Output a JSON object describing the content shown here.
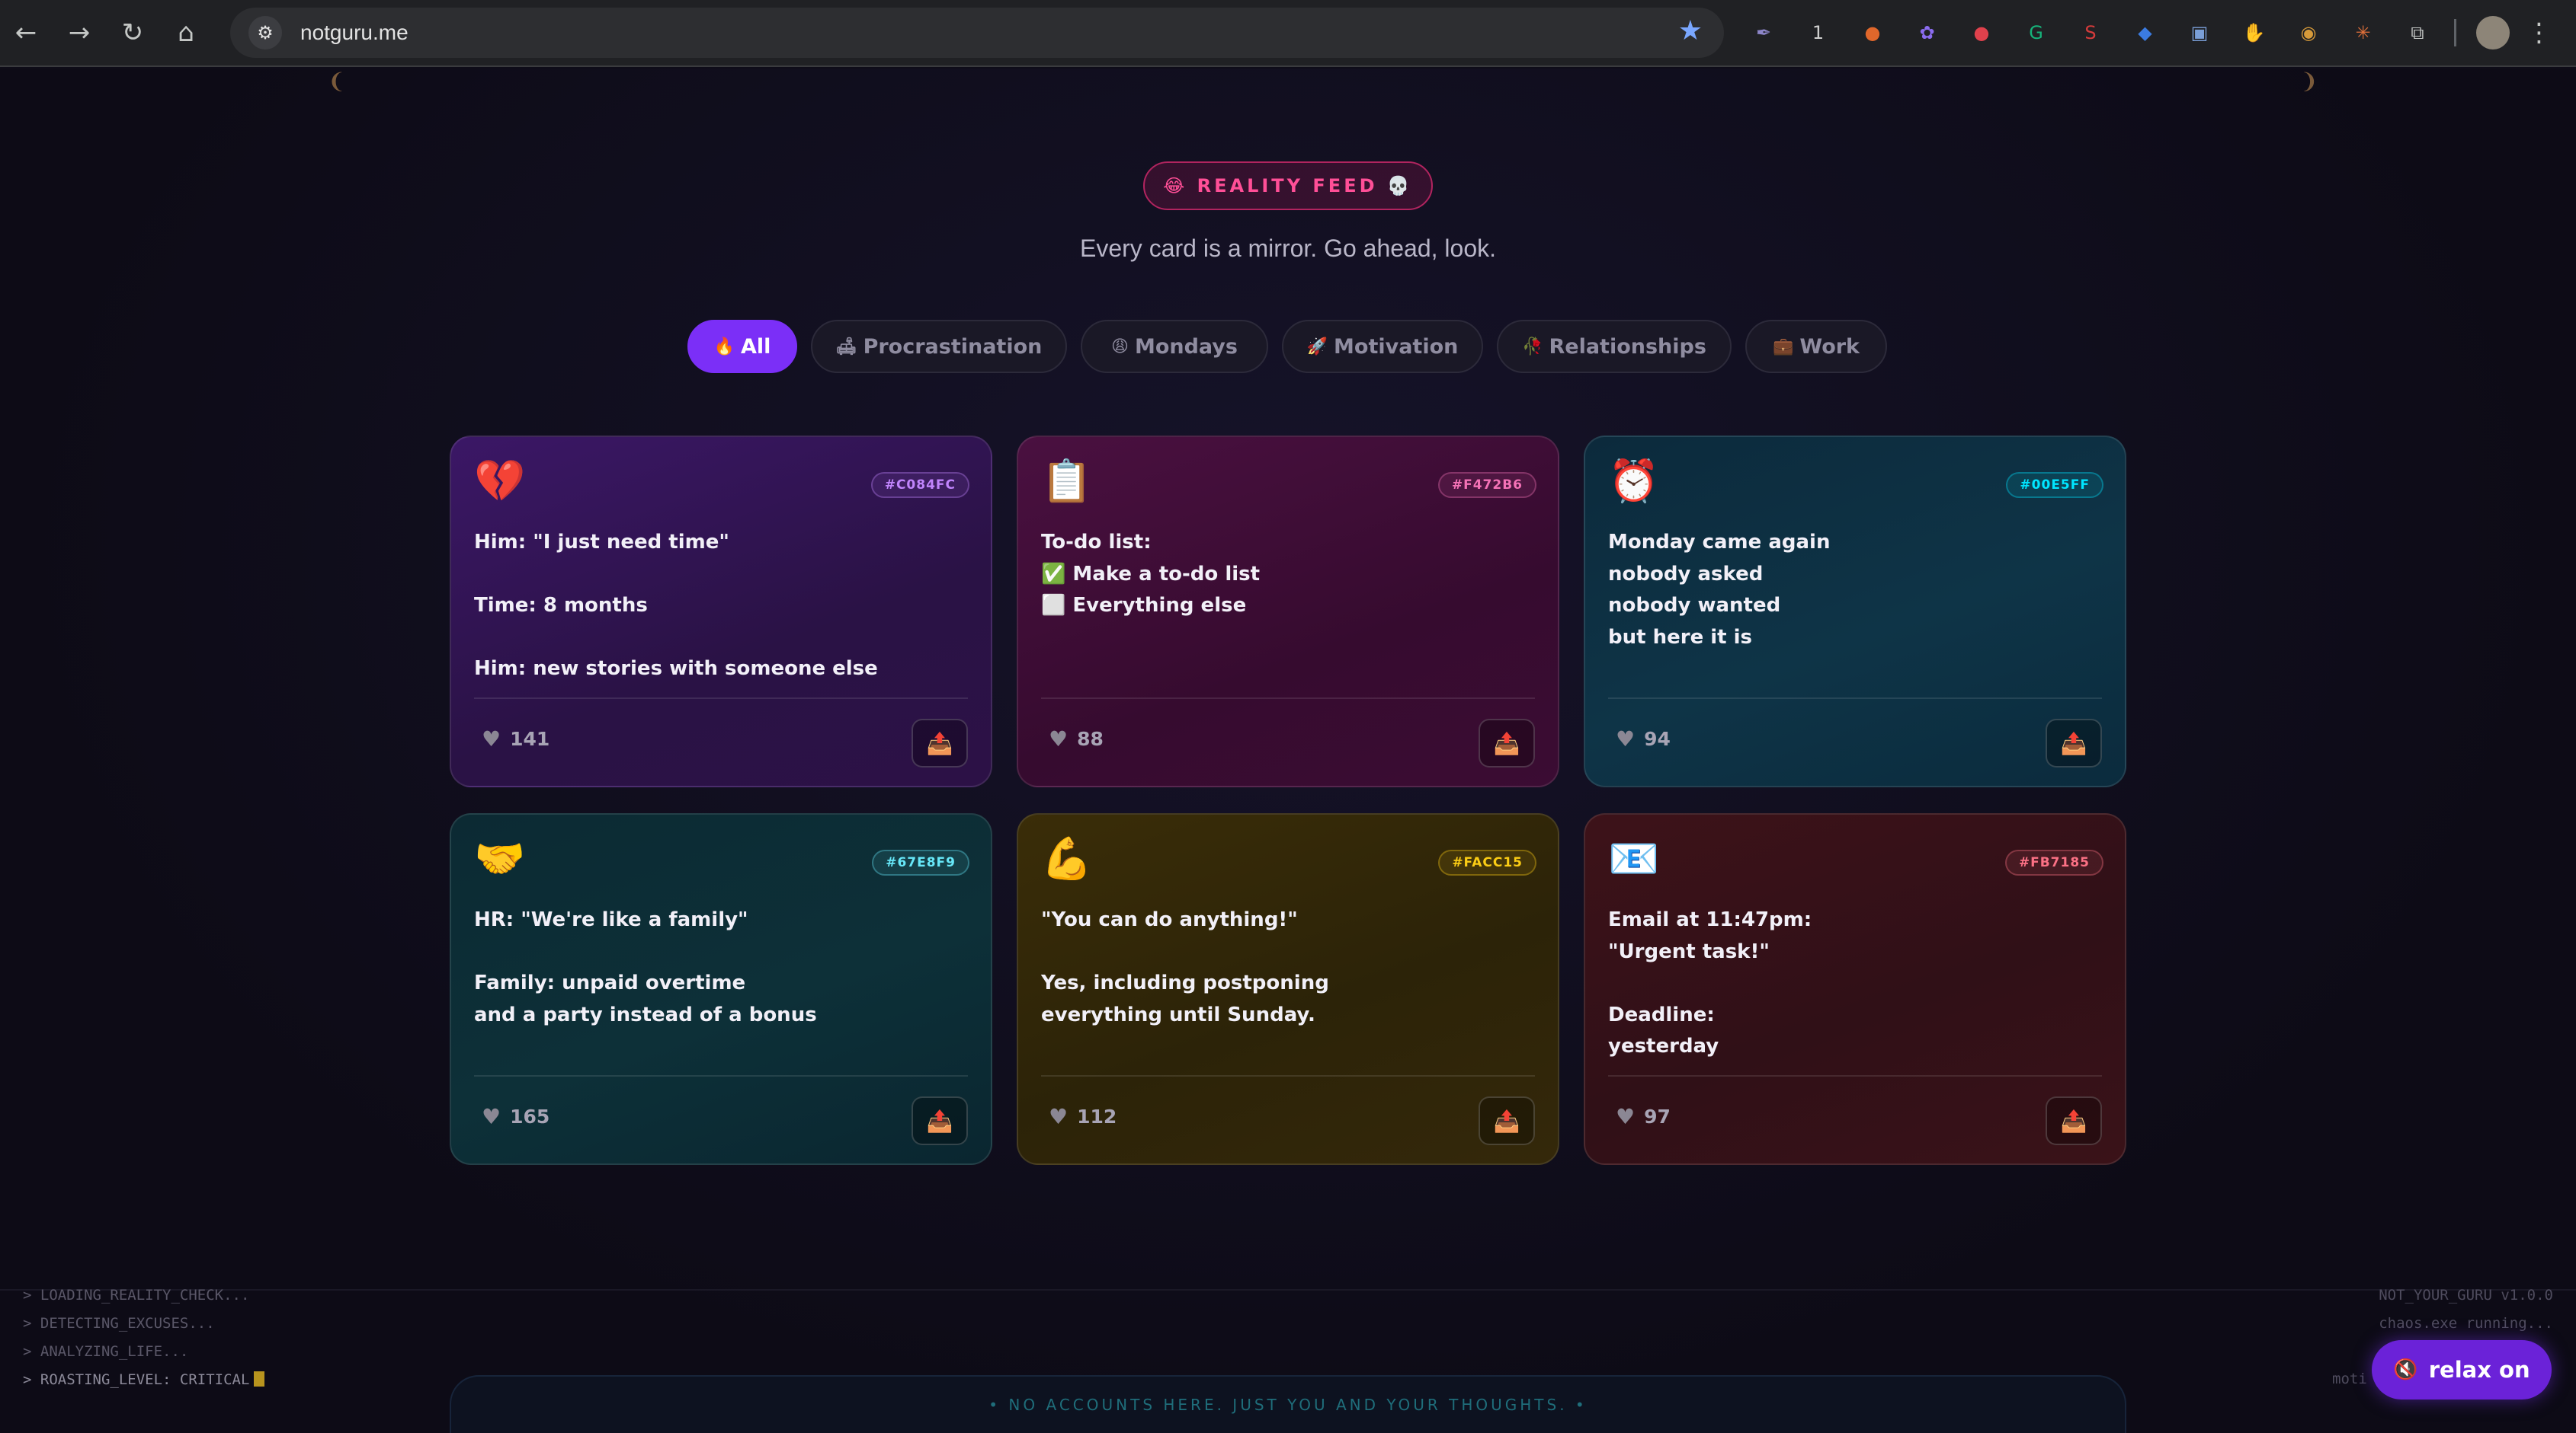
{
  "browser": {
    "url": "notguru.me",
    "nav": {
      "back": "←",
      "forward": "→",
      "reload": "↻",
      "home": "⌂"
    },
    "icons": {
      "site_settings": "site-settings-icon",
      "bookmark_star": "star-icon",
      "menu": "more-vert-icon"
    },
    "extensions": [
      {
        "name": "feather-extension-icon",
        "glyph": "✒",
        "color": "#8d86c9"
      },
      {
        "name": "password-extension-icon",
        "glyph": "1",
        "color": "#cfcfcf"
      },
      {
        "name": "orange-extension-icon",
        "glyph": "●",
        "color": "#e0672b"
      },
      {
        "name": "gear-extension-icon",
        "glyph": "✿",
        "color": "#8b6cf0"
      },
      {
        "name": "red-extension-icon",
        "glyph": "●",
        "color": "#e0414c"
      },
      {
        "name": "grammarly-extension-icon",
        "glyph": "G",
        "color": "#16b37a"
      },
      {
        "name": "s-extension-icon",
        "glyph": "S",
        "color": "#d63b3b"
      },
      {
        "name": "tag-extension-icon",
        "glyph": "◆",
        "color": "#3b7be0"
      },
      {
        "name": "screen-extension-icon",
        "glyph": "▣",
        "color": "#7a9fd8"
      },
      {
        "name": "hand-extension-icon",
        "glyph": "✋",
        "color": "#e3a33c"
      },
      {
        "name": "circle-extension-icon",
        "glyph": "◉",
        "color": "#d69a3a"
      },
      {
        "name": "sparkle-extension-icon",
        "glyph": "✳",
        "color": "#e0703a"
      },
      {
        "name": "puzzle-extension-icon",
        "glyph": "⧉",
        "color": "#c4c7c5"
      }
    ]
  },
  "header": {
    "badge": "😂 REALITY FEED 💀",
    "subtitle": "Every card is a mirror. Go ahead, look."
  },
  "filters": [
    {
      "icon": "🔥",
      "label": "All",
      "active": true
    },
    {
      "icon": "🛋",
      "label": "Procrastination",
      "active": false
    },
    {
      "icon": "😩",
      "label": "Mondays",
      "active": false
    },
    {
      "icon": "🚀",
      "label": "Motivation",
      "active": false
    },
    {
      "icon": "🥀",
      "label": "Relationships",
      "active": false
    },
    {
      "icon": "💼",
      "label": "Work",
      "active": false
    }
  ],
  "cards": [
    {
      "emoji": "💔",
      "tag": "#C084FC",
      "tag_color": "#c084fc",
      "text": "Him: \"I just need time\"\n\nTime: 8 months\n\nHim: new stories with someone else",
      "likes": "141"
    },
    {
      "emoji": "📋",
      "tag": "#F472B6",
      "tag_color": "#f472b6",
      "text": "To-do list:\n✅ Make a to-do list\n⬜ Everything else",
      "likes": "88"
    },
    {
      "emoji": "⏰",
      "tag": "#00E5FF",
      "tag_color": "#00e5ff",
      "text": "Monday came again\nnobody asked\nnobody wanted\nbut here it is",
      "likes": "94"
    },
    {
      "emoji": "🤝",
      "tag": "#67E8F9",
      "tag_color": "#67e8f9",
      "text": "HR: \"We're like a family\"\n\nFamily: unpaid overtime\nand a party instead of a bonus",
      "likes": "165"
    },
    {
      "emoji": "💪",
      "tag": "#FACC15",
      "tag_color": "#facc15",
      "text": "\"You can do anything!\"\n\nYes, including postponing\neverything until Sunday.",
      "likes": "112"
    },
    {
      "emoji": "📧",
      "tag": "#FB7185",
      "tag_color": "#fb7185",
      "text": "Email at 11:47pm:\n\"Urgent task!\"\n\nDeadline:\nyesterday",
      "likes": "97"
    }
  ],
  "card_icons": {
    "like": "heart-icon",
    "share": "share-icon"
  },
  "terminal": {
    "lines": [
      "> LOADING_REALITY_CHECK...",
      "> DETECTING_EXCUSES...",
      "> ANALYZING_LIFE...",
      "> ROASTING_LEVEL: CRITICAL"
    ],
    "right_lines": [
      "NOT_YOUR_GURU v1.0.0",
      "chaos.exe running..."
    ],
    "moti": "moti"
  },
  "footer": {
    "banner": "• NO ACCOUNTS HERE. JUST YOU AND YOUR THOUGHTS. •",
    "relax_label": "relax on",
    "relax_icon": "🔇"
  }
}
